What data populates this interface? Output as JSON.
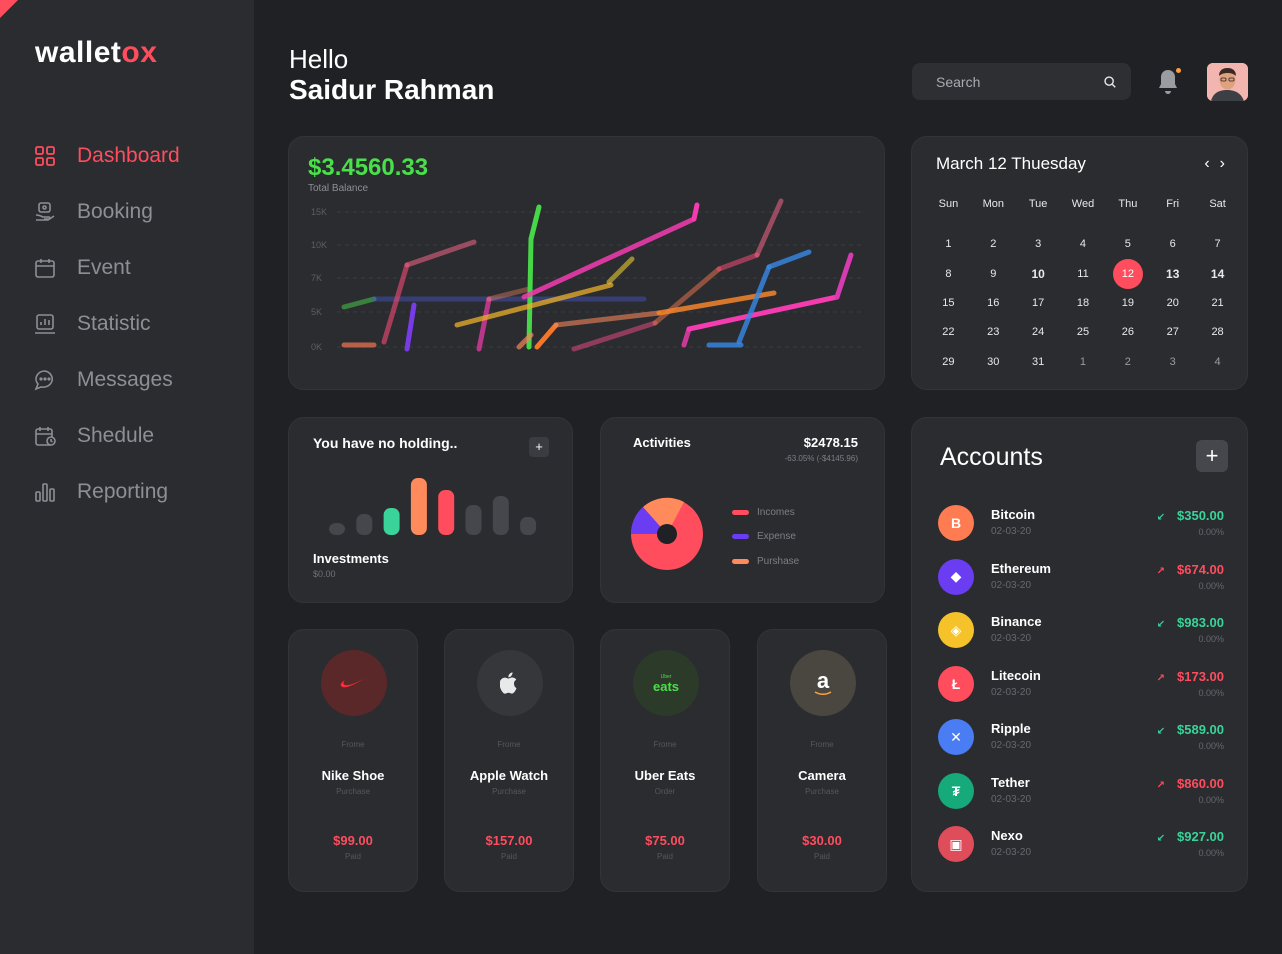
{
  "app": {
    "logo_main": "wallet",
    "logo_accent": "ox"
  },
  "sidebar": {
    "items": [
      {
        "label": "Dashboard",
        "icon": "grid-icon",
        "active": true
      },
      {
        "label": "Booking",
        "icon": "hand-icon"
      },
      {
        "label": "Event",
        "icon": "calendar-icon"
      },
      {
        "label": "Statistic",
        "icon": "chart-icon"
      },
      {
        "label": "Messages",
        "icon": "chat-icon"
      },
      {
        "label": "Shedule",
        "icon": "schedule-icon"
      },
      {
        "label": "Reporting",
        "icon": "bar-chart-icon"
      }
    ]
  },
  "header": {
    "greeting": "Hello",
    "name": "Saidur Rahman",
    "search_placeholder": "Search"
  },
  "balance": {
    "value": "$3.4560.33",
    "label": "Total Balance",
    "y_ticks": [
      "15K",
      "10K",
      "7K",
      "5K",
      "0K"
    ]
  },
  "calendar": {
    "title": "March 12 Thuesday",
    "weekdays": [
      "Sun",
      "Mon",
      "Tue",
      "Wed",
      "Thu",
      "Fri",
      "Sat"
    ],
    "weeks": [
      [
        "1",
        "2",
        "3",
        "4",
        "5",
        "6",
        "7"
      ],
      [
        "8",
        "9",
        "10",
        "11",
        "12",
        "13",
        "14"
      ],
      [
        "15",
        "16",
        "17",
        "18",
        "19",
        "20",
        "21"
      ],
      [
        "22",
        "23",
        "24",
        "25",
        "26",
        "27",
        "28"
      ],
      [
        "29",
        "30",
        "31",
        "1",
        "2",
        "3",
        "4"
      ]
    ],
    "selected": "12"
  },
  "holdings": {
    "title": "You have no holding..",
    "label": "Investments",
    "value": "$0.00",
    "bars": [
      0.2,
      0.35,
      0.45,
      0.95,
      0.75,
      0.5,
      0.65,
      0.3
    ]
  },
  "activities": {
    "title": "Activities",
    "value": "$2478.15",
    "sub": "-63.05% (-$4145.96)",
    "legend": [
      {
        "label": "Incomes",
        "color": "#ff4d5e"
      },
      {
        "label": "Expense",
        "color": "#6a3cf2"
      },
      {
        "label": "Purshase",
        "color": "#ff8a5c"
      }
    ]
  },
  "purchases": [
    {
      "from": "Frome",
      "name": "Nike Shoe",
      "type": "Purchase",
      "price": "$99.00",
      "status": "Paid",
      "icon": "nike-logo-icon"
    },
    {
      "from": "Frome",
      "name": "Apple Watch",
      "type": "Purchase",
      "price": "$157.00",
      "status": "Paid",
      "icon": "apple-logo-icon"
    },
    {
      "from": "Frome",
      "name": "Uber Eats",
      "type": "Order",
      "price": "$75.00",
      "status": "Paid",
      "icon": "uber-eats-logo-icon",
      "logo_text": "eats",
      "logo_small": "Uber"
    },
    {
      "from": "Frome",
      "name": "Camera",
      "type": "Purchase",
      "price": "$30.00",
      "status": "Paid",
      "icon": "amazon-logo-icon",
      "logo_text": "a"
    }
  ],
  "accounts": {
    "title": "Accounts",
    "add_label": "+",
    "items": [
      {
        "name": "Bitcoin",
        "date": "02-03-20",
        "amount": "$350.00",
        "pct": "0.00%",
        "dir": "down",
        "color": "#ff7b52",
        "symbol": "B"
      },
      {
        "name": "Ethereum",
        "date": "02-03-20",
        "amount": "$674.00",
        "pct": "0.00%",
        "dir": "up",
        "color": "#6a3cf2",
        "symbol": "◆"
      },
      {
        "name": "Binance",
        "date": "02-03-20",
        "amount": "$983.00",
        "pct": "0.00%",
        "dir": "down",
        "color": "#f5c22a",
        "symbol": "◈"
      },
      {
        "name": "Litecoin",
        "date": "02-03-20",
        "amount": "$173.00",
        "pct": "0.00%",
        "dir": "up",
        "color": "#ff4d5e",
        "symbol": "Ł"
      },
      {
        "name": "Ripple",
        "date": "02-03-20",
        "amount": "$589.00",
        "pct": "0.00%",
        "dir": "down",
        "color": "#4a7cf3",
        "symbol": "✕"
      },
      {
        "name": "Tether",
        "date": "02-03-20",
        "amount": "$860.00",
        "pct": "0.00%",
        "dir": "up",
        "color": "#16a97a",
        "symbol": "₮"
      },
      {
        "name": "Nexo",
        "date": "02-03-20",
        "amount": "$927.00",
        "pct": "0.00%",
        "dir": "down",
        "color": "#e04d5a",
        "symbol": "▣"
      }
    ]
  },
  "colors": {
    "accent": "#ff4d5e",
    "green": "#49e04a",
    "teal": "#3ad49a"
  }
}
